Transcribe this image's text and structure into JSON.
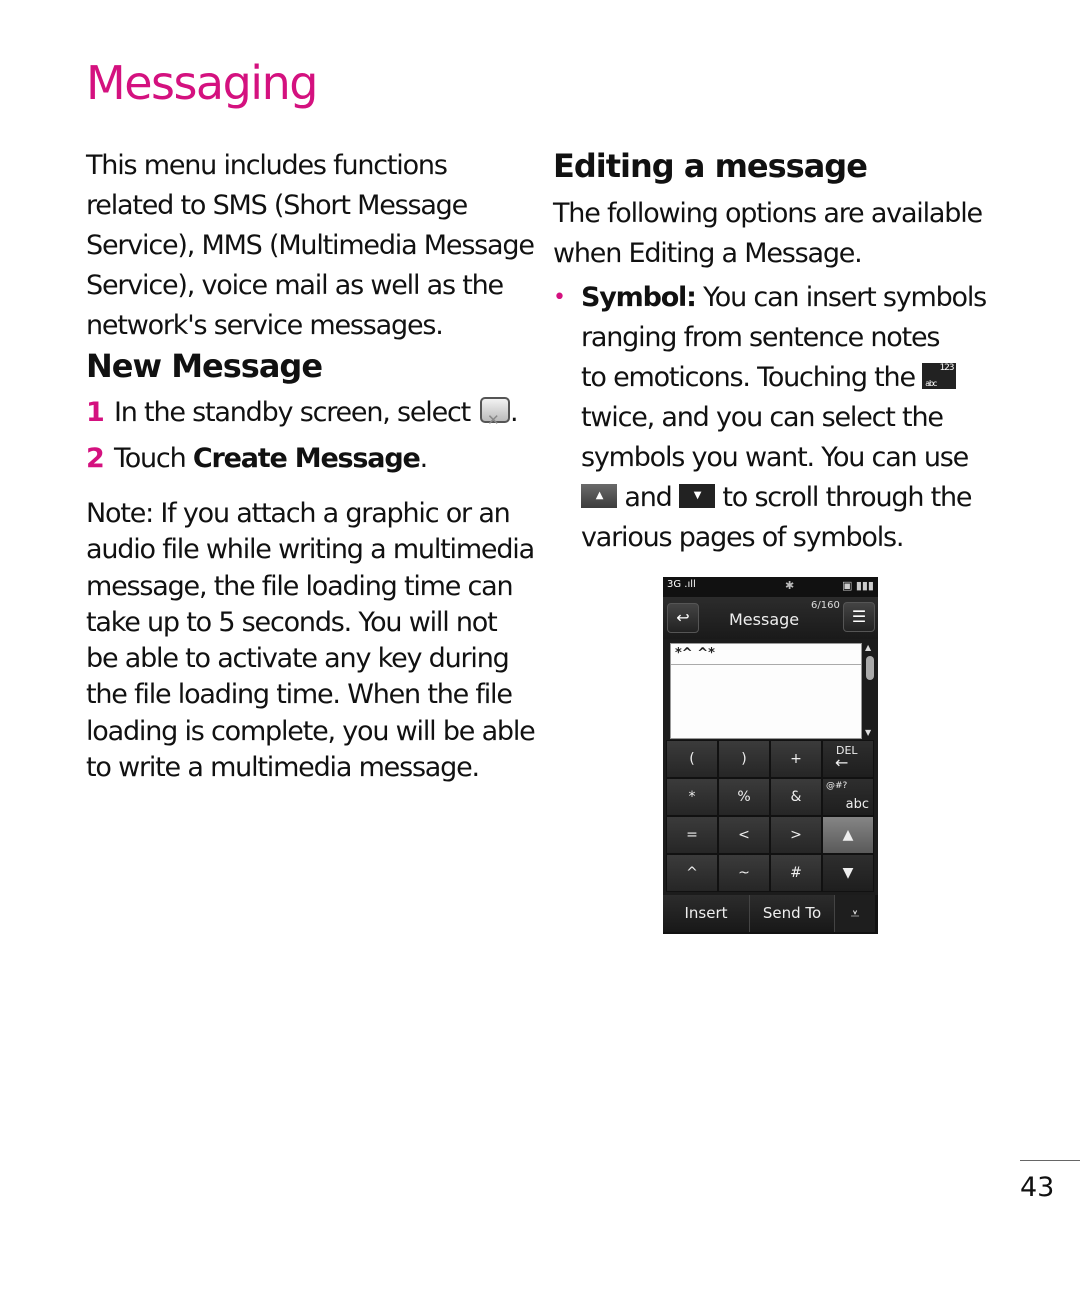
{
  "page": {
    "title": "Messaging",
    "page_number": "43"
  },
  "left": {
    "intro_lines": [
      "This menu includes functions",
      "related to SMS (Short Message",
      "Service), MMS (Multimedia Message",
      "Service), voice mail as well as the",
      "network's service messages."
    ],
    "new_message": {
      "heading": "New Message",
      "steps": [
        {
          "num": "1",
          "text": "In the standby screen, select",
          "icon": "message-icon",
          "suffix": "."
        },
        {
          "num": "2",
          "text": "Touch ",
          "bold": "Create Message",
          "suffix": "."
        }
      ]
    },
    "note_lines": [
      "Note: If you attach a graphic or an",
      "audio file while writing a multimedia",
      "message, the file loading time can",
      "take up to 5 seconds. You will not",
      "be able to activate any key during",
      "the file loading time. When the file",
      "loading is complete, you will be able",
      "to write a multimedia message."
    ]
  },
  "right": {
    "heading": "Editing a message",
    "intro_lines": [
      "The following options are available",
      "when Editing a Message."
    ],
    "bullet": {
      "marker": "•",
      "label": "Symbol:",
      "line1": " You can insert symbols",
      "line2": "ranging from sentence notes",
      "line3": "to emoticons. Touching the",
      "line4": "twice, and you can select the",
      "line5": "symbols you want. You can use",
      "line6_mid": " and ",
      "line6_end": " to scroll through the",
      "line7": "various pages of symbols.",
      "abc_icon_top": "abc",
      "abc_icon_bottom": "123",
      "up_icon": "▲",
      "down_icon": "▼"
    }
  },
  "phone": {
    "status": {
      "signal": "3G .ıll",
      "bluetooth": "✱",
      "battery": "▣ ▮▮▮"
    },
    "header": {
      "back": "↩",
      "title": "Message",
      "counter": "6/160",
      "menu": "☰"
    },
    "text_value": "*^ ^*",
    "scroll_up": "▲",
    "scroll_down": "▼",
    "keys": [
      {
        "label": "("
      },
      {
        "label": ")"
      },
      {
        "label": "+"
      },
      {
        "label": "DEL",
        "sub": "←"
      },
      {
        "label": "*"
      },
      {
        "label": "%"
      },
      {
        "label": "&"
      },
      {
        "label": "@#?",
        "sub": "abc"
      },
      {
        "label": "="
      },
      {
        "label": "<"
      },
      {
        "label": ">"
      },
      {
        "label": "▲"
      },
      {
        "label": "^"
      },
      {
        "label": "~"
      },
      {
        "label": "#"
      },
      {
        "label": "▼"
      }
    ],
    "bottom": {
      "insert": "Insert",
      "send_to": "Send To",
      "more": "⩡"
    }
  },
  "colors": {
    "accent": "#d4117f"
  }
}
